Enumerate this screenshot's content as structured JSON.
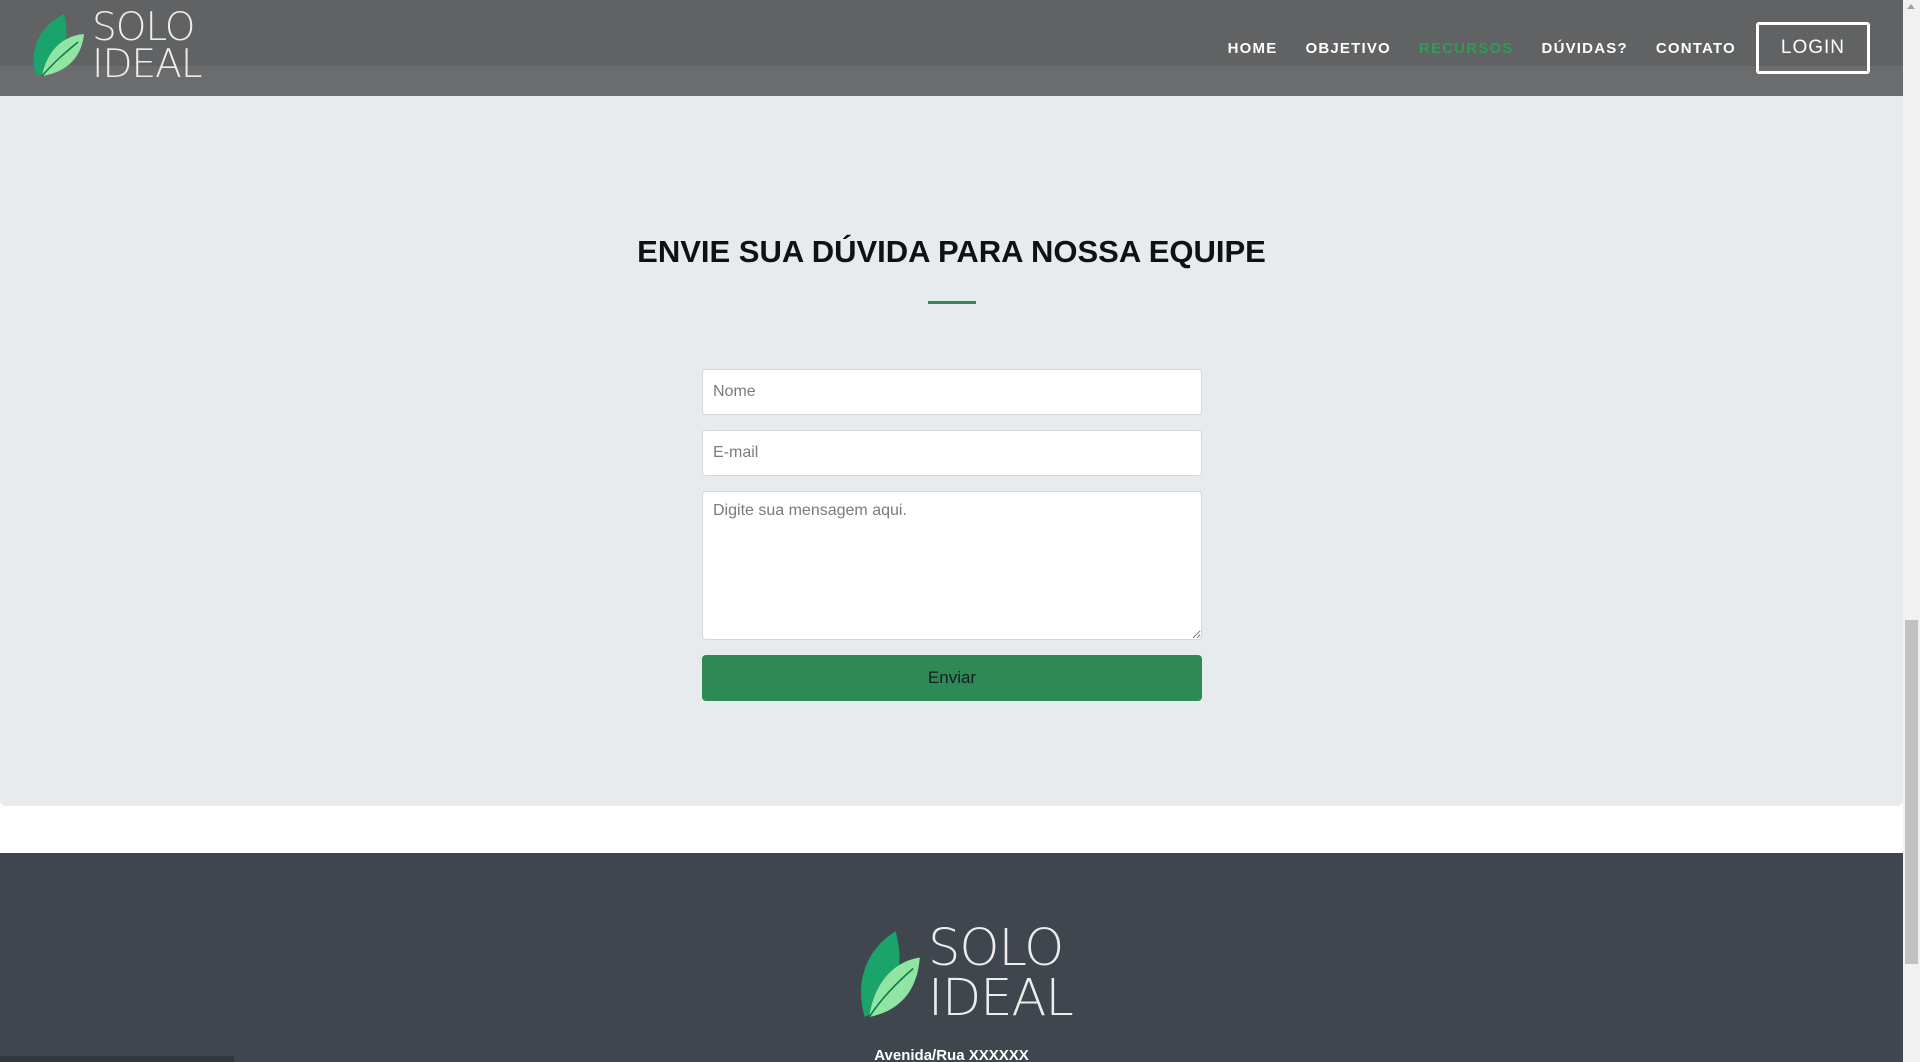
{
  "brand": {
    "line1": "SOLO",
    "line2": "IDEAL",
    "leaf_dark": "#1aa36b",
    "leaf_light": "#8fe5a1"
  },
  "nav": {
    "items": [
      {
        "label": "HOME",
        "active": false
      },
      {
        "label": "OBJETIVO",
        "active": false
      },
      {
        "label": "RECURSOS",
        "active": true
      },
      {
        "label": "DÚVIDAS?",
        "active": false
      },
      {
        "label": "CONTATO",
        "active": false
      }
    ],
    "login_label": "LOGIN",
    "active_color": "#2f9c57"
  },
  "contact": {
    "title": "ENVIE SUA DÚVIDA PARA NOSSA EQUIPE",
    "name_placeholder": "Nome",
    "email_placeholder": "E-mail",
    "message_placeholder": "Digite sua mensagem aqui.",
    "send_label": "Enviar",
    "accent_color": "#2e8a55"
  },
  "footer": {
    "address": "Avenida/Rua XXXXXX"
  }
}
